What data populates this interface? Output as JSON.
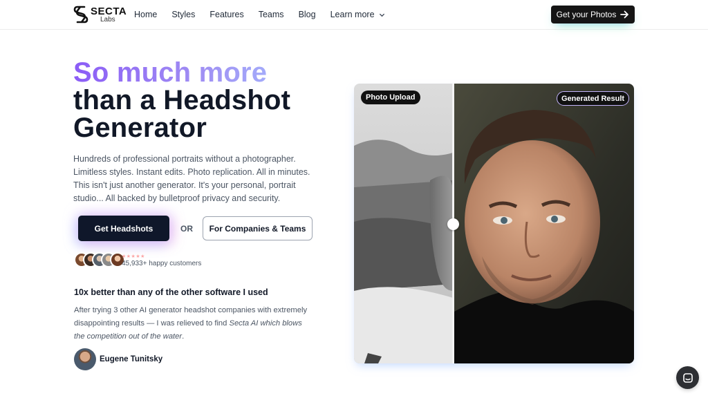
{
  "brand": {
    "name": "SECTA",
    "sub": "Labs"
  },
  "nav": {
    "links": [
      "Home",
      "Styles",
      "Features",
      "Teams",
      "Blog"
    ],
    "more_label": "Learn more",
    "cta_label": "Get your Photos"
  },
  "hero": {
    "title_line1": "So much more",
    "title_line2": "than a Headshot",
    "title_line3": "Generator",
    "lead": "Hundreds of professional portraits without a photographer. Limitless styles. Instant edits. Photo replication. All in minutes. This isn't just another generator. It's your personal, portrait studio... All backed by bulletproof privacy and security.",
    "primary_cta": "Get Headshots",
    "or_label": "OR",
    "secondary_cta": "For Companies & Teams",
    "stars": "★★★★★",
    "customers": "45,933+ happy customers"
  },
  "testimonial": {
    "title": "10x better than any of the other software I used",
    "body_plain": "After trying 3 other AI generator headshot companies with extremely disappointing results — I was relieved to find ",
    "body_emph": "Secta AI which blows the competition out of the water",
    "body_end": ".",
    "author": "Eugene Tunitsky"
  },
  "compare": {
    "left_label": "Photo Upload",
    "right_label": "Generated Result"
  },
  "colors": {
    "dark": "#0f172a",
    "accent": "#8b5cf6",
    "accent_light": "#a5b4fc"
  },
  "icons": {
    "cta_arrow": "arrow-right-icon",
    "more": "chevron-down-icon",
    "chat": "chat-icon"
  }
}
